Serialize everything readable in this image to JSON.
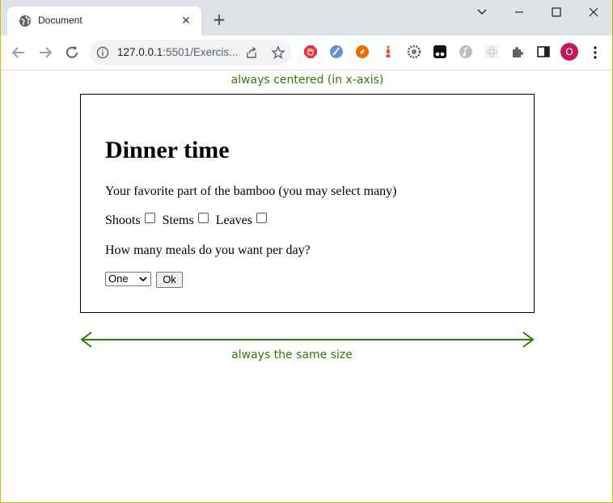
{
  "browser": {
    "tab_title": "Document",
    "url_host": "127.0.0.1",
    "url_rest": ":5501/Exercis...",
    "profile_initial": "O",
    "profile_color": "#c2185b"
  },
  "page": {
    "note_top": "always centered (in x-axis)",
    "note_bottom": "always the same size",
    "annotation_color": "#2e7d0a",
    "heading": "Dinner time",
    "question_parts": "Your favorite part of the bamboo (you may select many)",
    "options": [
      "Shoots",
      "Stems",
      "Leaves"
    ],
    "question_meals": "How many meals do you want per day?",
    "meals_selected": "One",
    "ok_label": "Ok"
  }
}
